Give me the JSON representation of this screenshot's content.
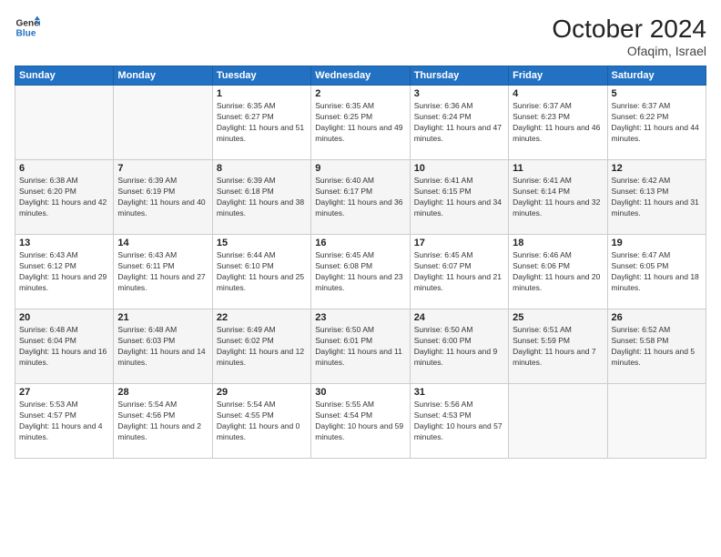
{
  "header": {
    "logo_line1": "General",
    "logo_line2": "Blue",
    "month": "October 2024",
    "location": "Ofaqim, Israel"
  },
  "weekdays": [
    "Sunday",
    "Monday",
    "Tuesday",
    "Wednesday",
    "Thursday",
    "Friday",
    "Saturday"
  ],
  "weeks": [
    [
      {
        "day": "",
        "info": ""
      },
      {
        "day": "",
        "info": ""
      },
      {
        "day": "1",
        "info": "Sunrise: 6:35 AM\nSunset: 6:27 PM\nDaylight: 11 hours and 51 minutes."
      },
      {
        "day": "2",
        "info": "Sunrise: 6:35 AM\nSunset: 6:25 PM\nDaylight: 11 hours and 49 minutes."
      },
      {
        "day": "3",
        "info": "Sunrise: 6:36 AM\nSunset: 6:24 PM\nDaylight: 11 hours and 47 minutes."
      },
      {
        "day": "4",
        "info": "Sunrise: 6:37 AM\nSunset: 6:23 PM\nDaylight: 11 hours and 46 minutes."
      },
      {
        "day": "5",
        "info": "Sunrise: 6:37 AM\nSunset: 6:22 PM\nDaylight: 11 hours and 44 minutes."
      }
    ],
    [
      {
        "day": "6",
        "info": "Sunrise: 6:38 AM\nSunset: 6:20 PM\nDaylight: 11 hours and 42 minutes."
      },
      {
        "day": "7",
        "info": "Sunrise: 6:39 AM\nSunset: 6:19 PM\nDaylight: 11 hours and 40 minutes."
      },
      {
        "day": "8",
        "info": "Sunrise: 6:39 AM\nSunset: 6:18 PM\nDaylight: 11 hours and 38 minutes."
      },
      {
        "day": "9",
        "info": "Sunrise: 6:40 AM\nSunset: 6:17 PM\nDaylight: 11 hours and 36 minutes."
      },
      {
        "day": "10",
        "info": "Sunrise: 6:41 AM\nSunset: 6:15 PM\nDaylight: 11 hours and 34 minutes."
      },
      {
        "day": "11",
        "info": "Sunrise: 6:41 AM\nSunset: 6:14 PM\nDaylight: 11 hours and 32 minutes."
      },
      {
        "day": "12",
        "info": "Sunrise: 6:42 AM\nSunset: 6:13 PM\nDaylight: 11 hours and 31 minutes."
      }
    ],
    [
      {
        "day": "13",
        "info": "Sunrise: 6:43 AM\nSunset: 6:12 PM\nDaylight: 11 hours and 29 minutes."
      },
      {
        "day": "14",
        "info": "Sunrise: 6:43 AM\nSunset: 6:11 PM\nDaylight: 11 hours and 27 minutes."
      },
      {
        "day": "15",
        "info": "Sunrise: 6:44 AM\nSunset: 6:10 PM\nDaylight: 11 hours and 25 minutes."
      },
      {
        "day": "16",
        "info": "Sunrise: 6:45 AM\nSunset: 6:08 PM\nDaylight: 11 hours and 23 minutes."
      },
      {
        "day": "17",
        "info": "Sunrise: 6:45 AM\nSunset: 6:07 PM\nDaylight: 11 hours and 21 minutes."
      },
      {
        "day": "18",
        "info": "Sunrise: 6:46 AM\nSunset: 6:06 PM\nDaylight: 11 hours and 20 minutes."
      },
      {
        "day": "19",
        "info": "Sunrise: 6:47 AM\nSunset: 6:05 PM\nDaylight: 11 hours and 18 minutes."
      }
    ],
    [
      {
        "day": "20",
        "info": "Sunrise: 6:48 AM\nSunset: 6:04 PM\nDaylight: 11 hours and 16 minutes."
      },
      {
        "day": "21",
        "info": "Sunrise: 6:48 AM\nSunset: 6:03 PM\nDaylight: 11 hours and 14 minutes."
      },
      {
        "day": "22",
        "info": "Sunrise: 6:49 AM\nSunset: 6:02 PM\nDaylight: 11 hours and 12 minutes."
      },
      {
        "day": "23",
        "info": "Sunrise: 6:50 AM\nSunset: 6:01 PM\nDaylight: 11 hours and 11 minutes."
      },
      {
        "day": "24",
        "info": "Sunrise: 6:50 AM\nSunset: 6:00 PM\nDaylight: 11 hours and 9 minutes."
      },
      {
        "day": "25",
        "info": "Sunrise: 6:51 AM\nSunset: 5:59 PM\nDaylight: 11 hours and 7 minutes."
      },
      {
        "day": "26",
        "info": "Sunrise: 6:52 AM\nSunset: 5:58 PM\nDaylight: 11 hours and 5 minutes."
      }
    ],
    [
      {
        "day": "27",
        "info": "Sunrise: 5:53 AM\nSunset: 4:57 PM\nDaylight: 11 hours and 4 minutes."
      },
      {
        "day": "28",
        "info": "Sunrise: 5:54 AM\nSunset: 4:56 PM\nDaylight: 11 hours and 2 minutes."
      },
      {
        "day": "29",
        "info": "Sunrise: 5:54 AM\nSunset: 4:55 PM\nDaylight: 11 hours and 0 minutes."
      },
      {
        "day": "30",
        "info": "Sunrise: 5:55 AM\nSunset: 4:54 PM\nDaylight: 10 hours and 59 minutes."
      },
      {
        "day": "31",
        "info": "Sunrise: 5:56 AM\nSunset: 4:53 PM\nDaylight: 10 hours and 57 minutes."
      },
      {
        "day": "",
        "info": ""
      },
      {
        "day": "",
        "info": ""
      }
    ]
  ]
}
